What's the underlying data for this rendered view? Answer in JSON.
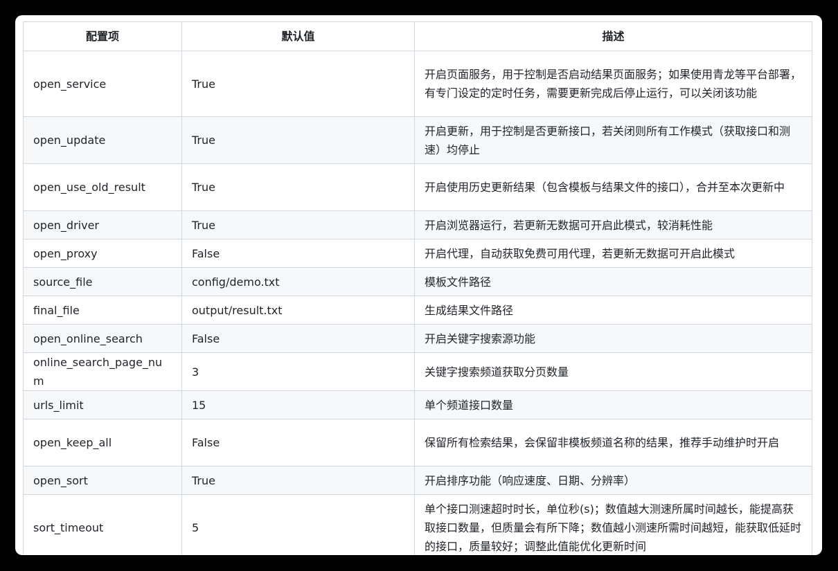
{
  "table": {
    "headers": [
      "配置项",
      "默认值",
      "描述"
    ],
    "rows": [
      {
        "key": "open_service",
        "default": "True",
        "desc": "开启页面服务，用于控制是否启动结果页面服务；如果使用青龙等平台部署，有专门设定的定时任务，需要更新完成后停止运行，可以关闭该功能"
      },
      {
        "key": "open_update",
        "default": "True",
        "desc": "开启更新，用于控制是否更新接口，若关闭则所有工作模式（获取接口和测速）均停止"
      },
      {
        "key": "open_use_old_result",
        "default": "True",
        "desc": "开启使用历史更新结果（包含模板与结果文件的接口），合并至本次更新中"
      },
      {
        "key": "open_driver",
        "default": "True",
        "desc": "开启浏览器运行，若更新无数据可开启此模式，较消耗性能"
      },
      {
        "key": "open_proxy",
        "default": "False",
        "desc": "开启代理，自动获取免费可用代理，若更新无数据可开启此模式"
      },
      {
        "key": "source_file",
        "default": "config/demo.txt",
        "desc": "模板文件路径"
      },
      {
        "key": "final_file",
        "default": "output/result.txt",
        "desc": "生成结果文件路径"
      },
      {
        "key": "open_online_search",
        "default": "False",
        "desc": "开启关键字搜索源功能"
      },
      {
        "key": "online_search_page_num",
        "default": "3",
        "desc": "关键字搜索频道获取分页数量"
      },
      {
        "key": "urls_limit",
        "default": "15",
        "desc": "单个频道接口数量"
      },
      {
        "key": "open_keep_all",
        "default": "False",
        "desc": "保留所有检索结果，会保留非模板频道名称的结果，推荐手动维护时开启"
      },
      {
        "key": "open_sort",
        "default": "True",
        "desc": "开启排序功能（响应速度、日期、分辨率）"
      },
      {
        "key": "sort_timeout",
        "default": "5",
        "desc": "单个接口测速超时时长，单位秒(s)；数值越大测速所属时间越长，能提高获取接口数量，但质量会有所下降；数值越小测速所需时间越短，能获取低延时的接口，质量较好；调整此值能优化更新时间"
      }
    ]
  }
}
